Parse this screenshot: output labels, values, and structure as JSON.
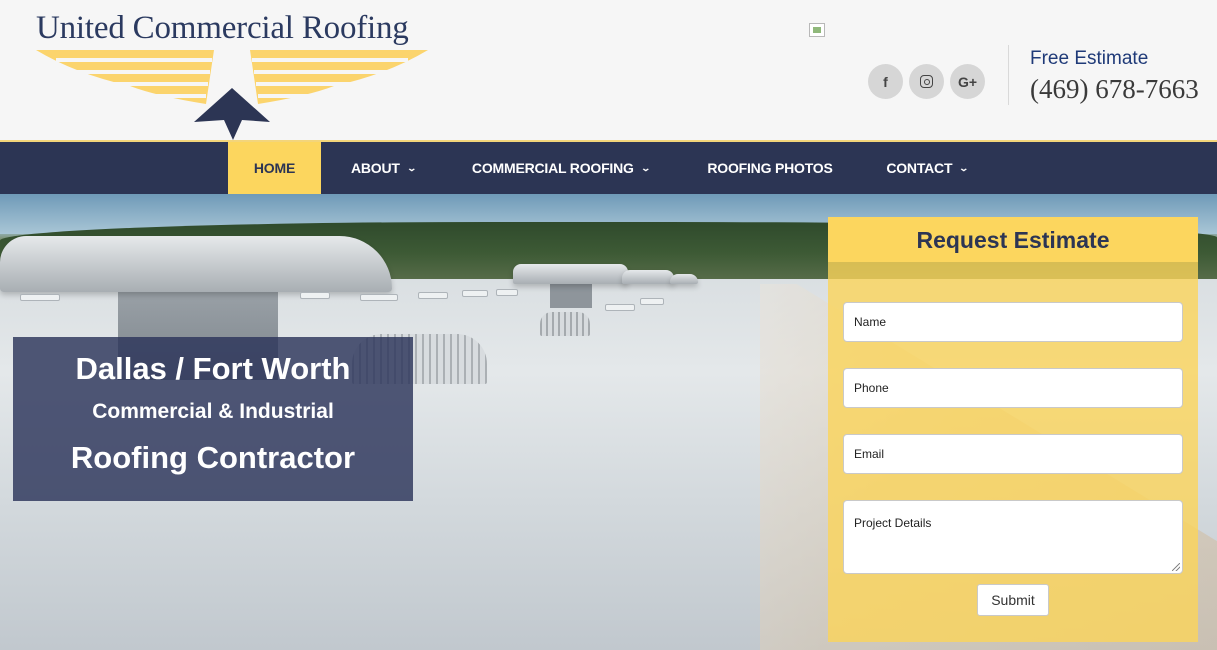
{
  "header": {
    "logo_text": "United Commercial Roofing",
    "free_estimate_label": "Free Estimate",
    "phone": "(469) 678-7663",
    "social": [
      {
        "name": "facebook-icon",
        "glyph": "f"
      },
      {
        "name": "instagram-icon",
        "glyph": ""
      },
      {
        "name": "google-plus-icon",
        "glyph": "G+"
      }
    ]
  },
  "nav": {
    "items": [
      {
        "label": "HOME",
        "active": true,
        "has_dropdown": false
      },
      {
        "label": "ABOUT",
        "active": false,
        "has_dropdown": true
      },
      {
        "label": "COMMERCIAL ROOFING",
        "active": false,
        "has_dropdown": true
      },
      {
        "label": "ROOFING PHOTOS",
        "active": false,
        "has_dropdown": false
      },
      {
        "label": "CONTACT",
        "active": false,
        "has_dropdown": true
      }
    ]
  },
  "hero": {
    "tagline_line1": "Dallas / Fort Worth",
    "tagline_line2": "Commercial & Industrial",
    "tagline_line3": "Roofing Contractor"
  },
  "form": {
    "title": "Request Estimate",
    "name_placeholder": "Name",
    "phone_placeholder": "Phone",
    "email_placeholder": "Email",
    "details_placeholder": "Project Details",
    "submit_label": "Submit"
  },
  "colors": {
    "navy": "#2c3554",
    "accent_yellow": "#fcd65e",
    "link_blue": "#1f3a78"
  }
}
